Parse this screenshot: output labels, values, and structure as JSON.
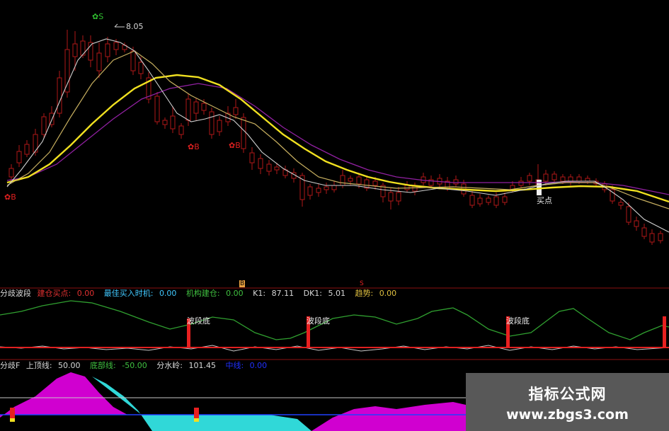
{
  "main": {
    "peak_label": "8.05",
    "sell_marker": "S",
    "buy_marker": "B",
    "buy_point_label": "买点"
  },
  "sep_markers": {
    "buy": "B",
    "sell": "S"
  },
  "panel1": {
    "title": "分歧波段",
    "items": [
      {
        "label": "建仓买点:",
        "value": "0.00",
        "color": "#e03030"
      },
      {
        "label": "最佳买入时机:",
        "value": "0.00",
        "color": "#40c8ff"
      },
      {
        "label": "机构建仓:",
        "value": "0.00",
        "color": "#40c040"
      },
      {
        "label": "K1:",
        "value": "87.11",
        "color": "#d8d8d8"
      },
      {
        "label": "DK1:",
        "value": "5.01",
        "color": "#d8d8d8"
      },
      {
        "label": "趋势:",
        "value": "0.00",
        "color": "#e0c040"
      }
    ],
    "bottom_label": "波段底"
  },
  "panel2": {
    "title": "分歧F",
    "items": [
      {
        "label": "上顶线:",
        "value": "50.00",
        "color": "#d8d8d8"
      },
      {
        "label": "底部线:",
        "value": "-50.00",
        "color": "#40c040"
      },
      {
        "label": "分水岭:",
        "value": "101.45",
        "color": "#d8d8d8"
      },
      {
        "label": "中线:",
        "value": "0.00",
        "color": "#2030ff"
      }
    ]
  },
  "watermark": {
    "title": "指标公式网",
    "url": "www.zbgs3.com"
  },
  "colors": {
    "up": "#b01818",
    "down": "#30a030",
    "ma_white": "#d0d0d0",
    "ma_khaki": "#c8b060",
    "ma_yellow": "#f0e020",
    "ma_purple": "#9020a0",
    "magenta": "#d000d0",
    "cyan": "#30d8d8"
  }
}
